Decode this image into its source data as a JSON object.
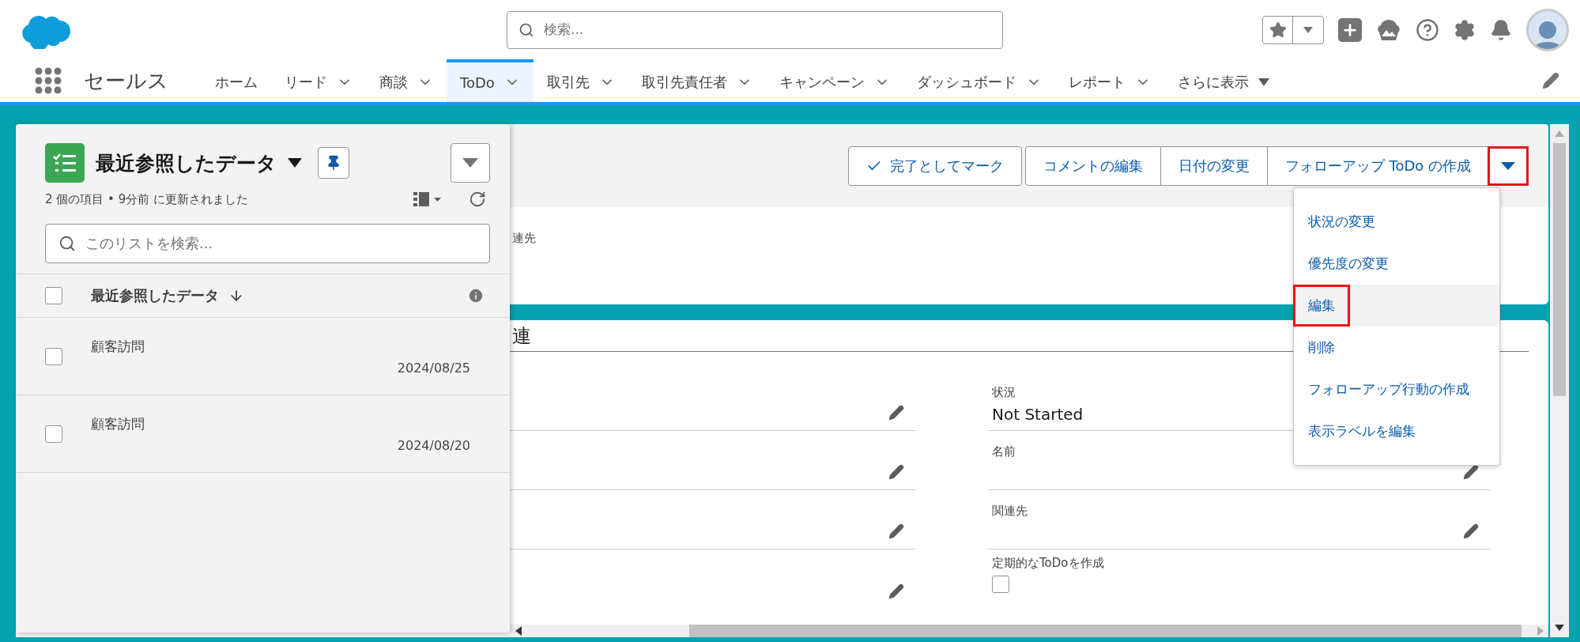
{
  "header": {
    "search": {
      "placeholder": "検索..."
    }
  },
  "nav": {
    "app_name": "セールス",
    "tabs": [
      {
        "label": "ホーム",
        "kind": "plain",
        "selected": false
      },
      {
        "label": "リード",
        "kind": "menu",
        "selected": false
      },
      {
        "label": "商談",
        "kind": "menu",
        "selected": false
      },
      {
        "label": "ToDo",
        "kind": "menu",
        "selected": true
      },
      {
        "label": "取引先",
        "kind": "menu",
        "selected": false
      },
      {
        "label": "取引先責任者",
        "kind": "menu",
        "selected": false
      },
      {
        "label": "キャンペーン",
        "kind": "menu",
        "selected": false
      },
      {
        "label": "ダッシュボード",
        "kind": "menu",
        "selected": false
      },
      {
        "label": "レポート",
        "kind": "menu",
        "selected": false
      },
      {
        "label": "さらに表示",
        "kind": "more",
        "selected": false
      }
    ]
  },
  "list_panel": {
    "title": "最近参照したデータ",
    "status": "2 個の項目 • 9分前 に更新されました",
    "search": {
      "placeholder": "このリストを検索..."
    },
    "column": {
      "label": "最近参照したデータ",
      "checked": false
    },
    "rows": [
      {
        "title": "顧客訪問",
        "date": "2024/08/25",
        "checked": false
      },
      {
        "title": "顧客訪問",
        "date": "2024/08/20",
        "checked": false
      }
    ]
  },
  "record": {
    "actions": [
      {
        "label": "完了としてマーク",
        "kind": "check"
      },
      {
        "label": "コメントの編集",
        "kind": "plain"
      },
      {
        "label": "日付の変更",
        "kind": "plain"
      },
      {
        "label": "フォローアップ ToDo の作成",
        "kind": "plain"
      }
    ],
    "menu_button": {
      "annotated": true
    },
    "highlights_label": "連先",
    "section_title": "連",
    "fields_right": [
      {
        "label": "状況",
        "value": "Not Started",
        "kind": "text"
      },
      {
        "label": "名前",
        "kind": "text"
      },
      {
        "label": "関連先",
        "kind": "text"
      },
      {
        "label": "定期的なToDoを作成",
        "kind": "checkbox",
        "checked": false
      }
    ]
  },
  "menu": {
    "items": [
      {
        "label": "状況の変更",
        "highlighted": false,
        "annotated": false
      },
      {
        "label": "優先度の変更",
        "highlighted": false,
        "annotated": false
      },
      {
        "label": "編集",
        "highlighted": true,
        "annotated": true
      },
      {
        "label": "削除",
        "highlighted": false,
        "annotated": false
      },
      {
        "label": "フォローアップ行動の作成",
        "highlighted": false,
        "annotated": false
      },
      {
        "label": "表示ラベルを編集",
        "highlighted": false,
        "annotated": false
      }
    ]
  }
}
